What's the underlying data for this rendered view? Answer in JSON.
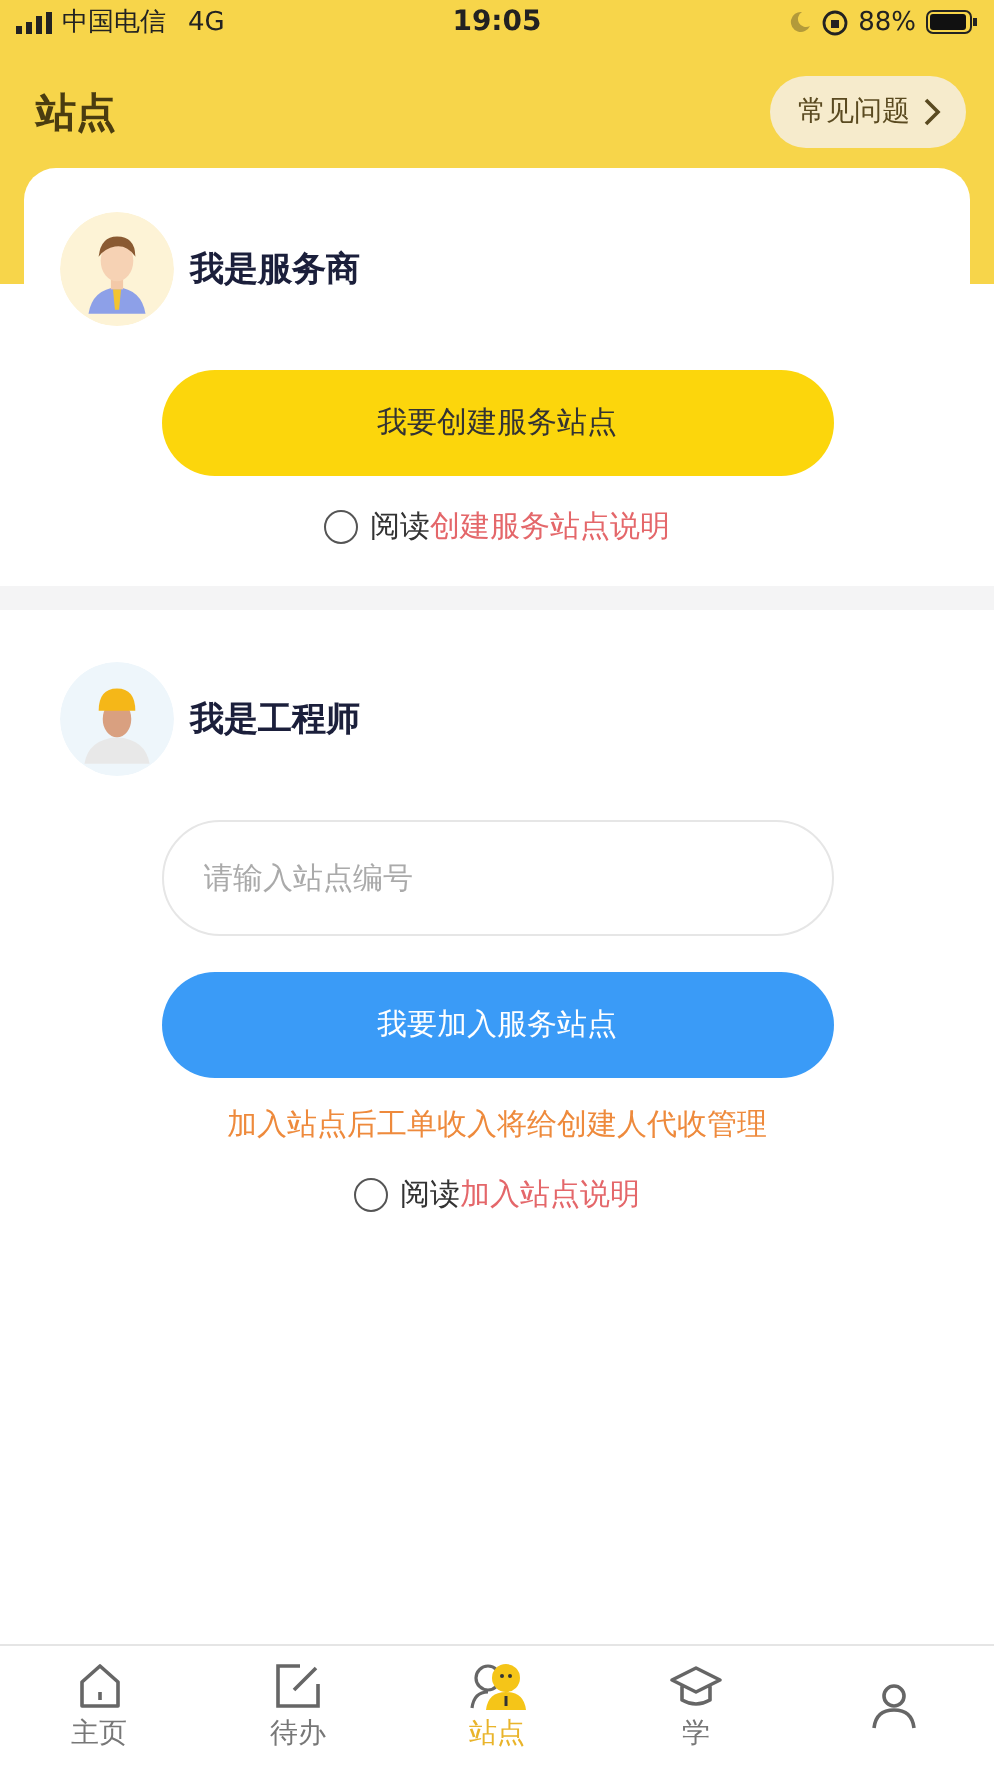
{
  "status_bar": {
    "carrier": "中国电信",
    "network": "4G",
    "time": "19:05",
    "battery": "88%"
  },
  "header": {
    "title": "站点",
    "faq_button": "常见问题"
  },
  "sections": [
    {
      "kind": "provider",
      "role": "我是服务商",
      "button": "我要创建服务站点",
      "agreement": {
        "checked": false,
        "prefix": "阅读",
        "link": "创建服务站点说明"
      }
    },
    {
      "kind": "engineer",
      "role": "我是工程师",
      "input": {
        "placeholder": "请输入站点编号"
      },
      "button": "我要加入服务站点",
      "note": "加入站点后工单收入将给创建人代收管理",
      "agreement": {
        "checked": false,
        "prefix": "阅读",
        "link": "加入站点说明"
      }
    }
  ],
  "tab_bar": [
    {
      "kind": "home",
      "label": "主页",
      "selected": false
    },
    {
      "kind": "edit",
      "label": "待办",
      "selected": false
    },
    {
      "kind": "people",
      "label": "站点",
      "selected": true
    },
    {
      "kind": "cap",
      "label": "学",
      "selected": false
    },
    {
      "kind": "person",
      "selected": false
    }
  ]
}
